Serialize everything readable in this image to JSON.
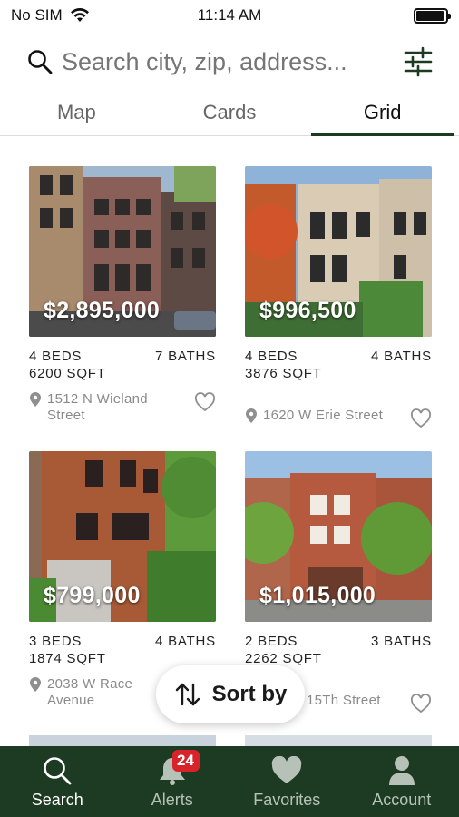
{
  "status_bar": {
    "carrier": "No SIM",
    "time": "11:14 AM",
    "battery_level": 0.95
  },
  "search": {
    "placeholder": "Search city, zip, address..."
  },
  "tabs": [
    {
      "label": "Map",
      "active": false
    },
    {
      "label": "Cards",
      "active": false
    },
    {
      "label": "Grid",
      "active": true
    }
  ],
  "listings": [
    {
      "price": "$2,895,000",
      "beds": "4 BEDS",
      "baths": "7 BATHS",
      "sqft": "6200 SQFT",
      "address_line1": "1512 N Wieland",
      "address_line2": "Street"
    },
    {
      "price": "$996,500",
      "beds": "4 BEDS",
      "baths": "4 BATHS",
      "sqft": "3876 SQFT",
      "address_line1": "1620 W Erie Street",
      "address_line2": ""
    },
    {
      "price": "$799,000",
      "beds": "3 BEDS",
      "baths": "4 BATHS",
      "sqft": "1874 SQFT",
      "address_line1": "2038 W Race",
      "address_line2": "Avenue"
    },
    {
      "price": "$1,015,000",
      "beds": "2 BEDS",
      "baths": "3 BATHS",
      "sqft": "2262 SQFT",
      "address_line1": "15Th Street",
      "address_line2": ""
    }
  ],
  "sort": {
    "label": "Sort by"
  },
  "bottom_nav": [
    {
      "label": "Search",
      "icon": "search-icon",
      "active": true
    },
    {
      "label": "Alerts",
      "icon": "bell-icon",
      "badge": "24"
    },
    {
      "label": "Favorites",
      "icon": "heart-icon"
    },
    {
      "label": "Account",
      "icon": "person-icon"
    }
  ],
  "colors": {
    "nav_bg": "#1d3a22",
    "accent": "#1a3a22",
    "badge": "#d8232a"
  }
}
